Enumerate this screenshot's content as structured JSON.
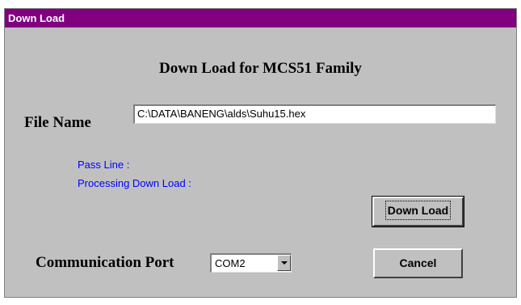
{
  "window": {
    "title": "Down Load"
  },
  "dialog": {
    "heading": "Down Load for MCS51 Family"
  },
  "file": {
    "label": "File Name",
    "value": "C:\\DATA\\BANENG\\alds\\Suhu15.hex"
  },
  "status": {
    "pass_line": "Pass Line :",
    "processing": "Processing Down Load :"
  },
  "buttons": {
    "download": "Down Load",
    "cancel": "Cancel"
  },
  "port": {
    "label": "Communication Port",
    "selected": "COM2"
  },
  "colors": {
    "title_bar": "#800080",
    "status_text": "#0000ff",
    "dialog_face": "#c0c0c0"
  },
  "icons": {
    "combo_arrow": "chevron-down-icon"
  }
}
